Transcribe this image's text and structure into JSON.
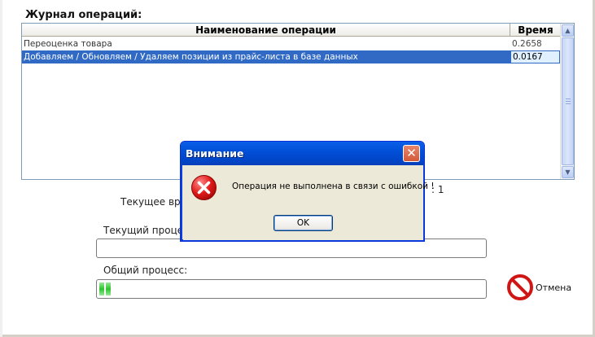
{
  "log": {
    "title": "Журнал операций:",
    "columns": {
      "name": "Наименование операции",
      "time": "Время"
    },
    "rows": [
      {
        "name": "Переоценка товара",
        "time": "0.2658",
        "selected": false
      },
      {
        "name": "Добавляем / Обновляем / Удаляем позиции из прайс-листа в базе данных",
        "time": "0.0167",
        "selected": true
      }
    ]
  },
  "status": {
    "current_time_label": "Текущее вре",
    "count_label": ": 1",
    "current_process_label": "Текущий процес",
    "total_process_label": "Общий процесс:"
  },
  "progress": {
    "current": 0,
    "total": 0.03
  },
  "cancel": {
    "label": "Отмена",
    "icon": "cancel-icon"
  },
  "dialog": {
    "title": "Внимание",
    "message": "Операция не выполнена в связи с ошибкой !",
    "ok_label": "OK",
    "icon": "error-icon"
  },
  "colors": {
    "selection": "#316ac5",
    "titlebar": "#0250d8",
    "dialog_bg": "#ece9d8",
    "progress": "#2bc42b"
  }
}
